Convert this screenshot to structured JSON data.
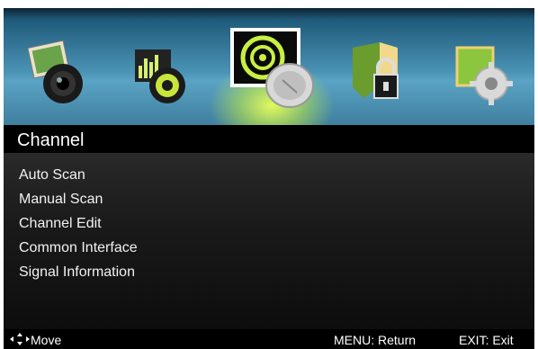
{
  "menu_title": "Channel",
  "icons": [
    {
      "name": "picture-icon"
    },
    {
      "name": "sound-icon"
    },
    {
      "name": "channel-icon",
      "selected": true
    },
    {
      "name": "lock-icon"
    },
    {
      "name": "setup-icon"
    }
  ],
  "items": [
    "Auto Scan",
    "Manual Scan",
    "Channel Edit",
    "Common Interface",
    "Signal Information"
  ],
  "footer": {
    "move": "Move",
    "menu": "MENU: Return",
    "exit": "EXIT: Exit"
  },
  "colors": {
    "highlight": "#e8ff5a"
  }
}
